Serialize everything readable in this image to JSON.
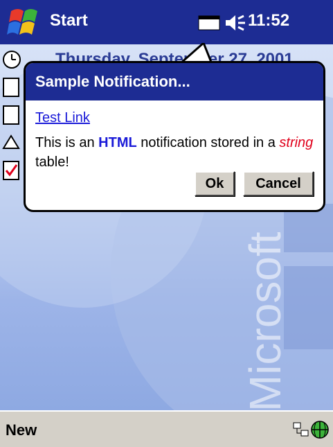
{
  "titlebar": {
    "start_label": "Start",
    "clock": "11:52",
    "bg_color": "#1d2c93"
  },
  "icons": {
    "start": "windows-flag-icon",
    "tray": "notification-window-icon",
    "speaker": "speaker-icon",
    "network": "network-icon",
    "globe": "globe-icon"
  },
  "today": {
    "date_text": "Thursday, September 27, 2001",
    "watermark_text": "Microsoft"
  },
  "notification": {
    "title": "Sample Notification...",
    "link_text": "Test Link",
    "message_before": "This is an ",
    "message_html_word": "HTML",
    "message_middle": " notification stored in a ",
    "message_string_word": "string",
    "message_after": " table!",
    "ok_label": "Ok",
    "cancel_label": "Cancel"
  },
  "bottombar": {
    "new_label": "New"
  }
}
